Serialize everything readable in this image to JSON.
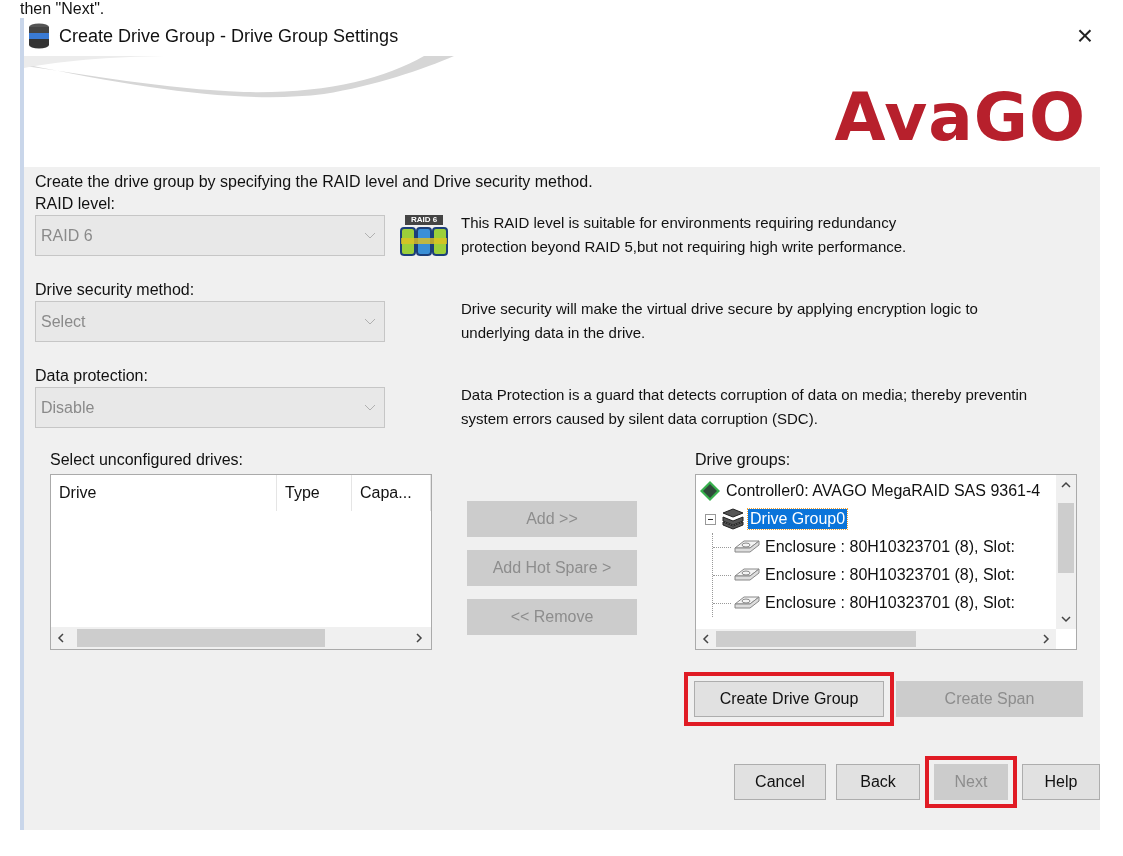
{
  "caption": "then \"Next\".",
  "window": {
    "title": "Create Drive Group - Drive Group Settings",
    "close": "×"
  },
  "logo": "AvaGO",
  "intro": "Create the drive group by specifying the RAID level and Drive security method.",
  "fields": [
    {
      "label": "RAID level:",
      "value": "RAID 6",
      "disabled": true,
      "badge": "RAID 6",
      "description": [
        "This RAID level is suitable for environments requiring redundancy",
        "protection beyond RAID 5,but not requiring high write performance."
      ]
    },
    {
      "label": "Drive security method:",
      "value": "Select",
      "disabled": true,
      "description": [
        "Drive security will make the virtual drive secure by applying encryption logic to",
        "underlying data in the drive."
      ]
    },
    {
      "label": "Data protection:",
      "value": "Disable",
      "disabled": true,
      "description": [
        "Data Protection is a guard that detects corruption of data on media; thereby preventin",
        "system errors caused by silent data corruption (SDC)."
      ]
    }
  ],
  "unconfigured": {
    "label": "Select unconfigured drives:",
    "columns": [
      "Drive",
      "Type",
      "Capa..."
    ]
  },
  "transfer_buttons": [
    {
      "label": "Add >>",
      "disabled": true
    },
    {
      "label": "Add Hot Spare >",
      "disabled": true
    },
    {
      "label": "<< Remove",
      "disabled": true
    }
  ],
  "drive_groups": {
    "label": "Drive groups:",
    "tree": [
      {
        "kind": "controller",
        "label": "Controller0: AVAGO MegaRAID SAS 9361-4",
        "selected": false
      },
      {
        "kind": "group",
        "label": "Drive Group0",
        "selected": true,
        "expanded": true,
        "children": [
          {
            "kind": "drive",
            "label": "Enclosure : 80H10323701 (8), Slot:",
            "selected": false
          },
          {
            "kind": "drive",
            "label": "Enclosure : 80H10323701 (8), Slot:",
            "selected": false
          },
          {
            "kind": "drive",
            "label": "Enclosure : 80H10323701 (8), Slot:",
            "selected": false
          }
        ]
      }
    ]
  },
  "group_buttons": [
    {
      "label": "Create Drive Group",
      "disabled": false,
      "highlighted": true
    },
    {
      "label": "Create Span",
      "disabled": true,
      "highlighted": false
    }
  ],
  "footer_buttons": [
    {
      "label": "Cancel",
      "disabled": false,
      "highlighted": false
    },
    {
      "label": "Back",
      "disabled": false,
      "highlighted": false
    },
    {
      "label": "Next",
      "disabled": true,
      "highlighted": true
    },
    {
      "label": "Help",
      "disabled": false,
      "highlighted": false
    }
  ]
}
